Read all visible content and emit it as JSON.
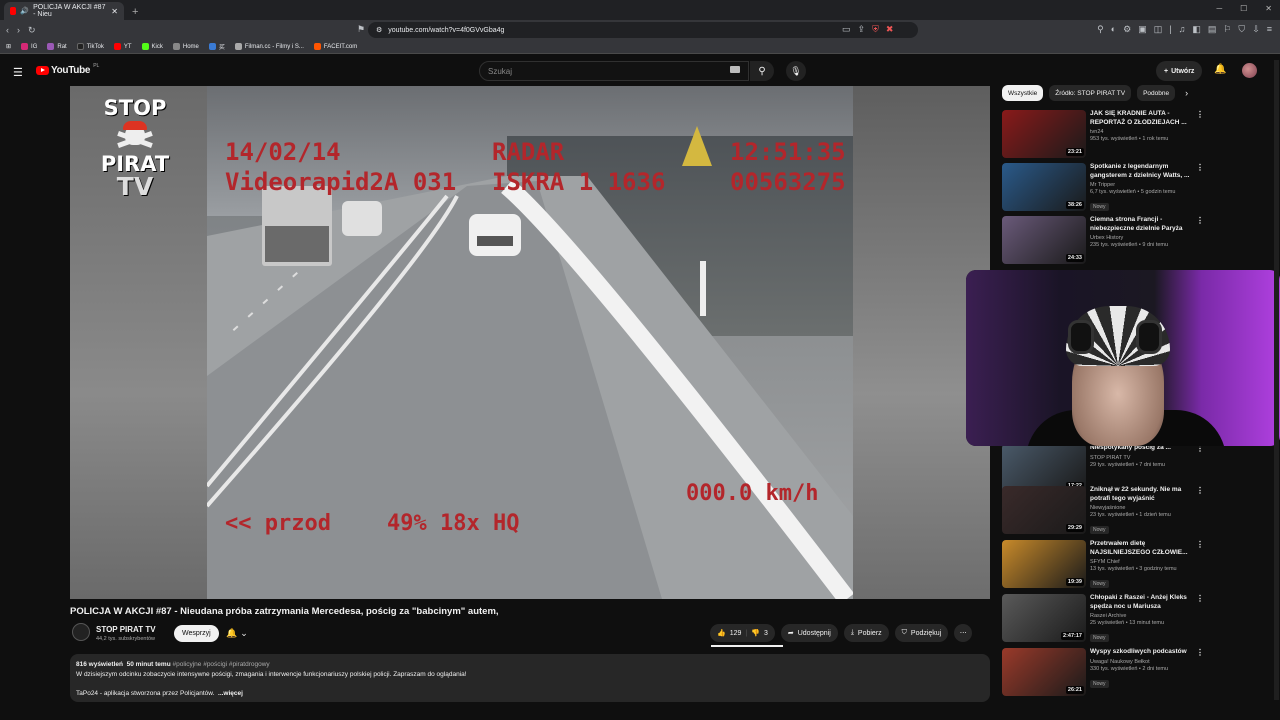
{
  "browser": {
    "tab_title": "POLICJA W AKCJI #87 - Nieu",
    "new_tab": "+",
    "url": "youtube.com/watch?v=4f0GVvGba4g",
    "bookmarks": [
      {
        "label": "IG",
        "color": "#d62976"
      },
      {
        "label": "Rat",
        "color": "#9b59b6"
      },
      {
        "label": "TikTok",
        "color": "#222222"
      },
      {
        "label": "YT",
        "color": "#ff0000"
      },
      {
        "label": "Kick",
        "color": "#53fc18"
      },
      {
        "label": "Home",
        "color": "#888888"
      },
      {
        "label": "买",
        "color": "#3a7bd5"
      },
      {
        "label": "Filman.cc - Filmy i S...",
        "color": "#aaaaaa"
      },
      {
        "label": "FACEIT.com",
        "color": "#ff5500"
      }
    ]
  },
  "youtube": {
    "logo": "YouTube",
    "region": "PL",
    "search_placeholder": "Szukaj",
    "create_label": "Utwórz"
  },
  "video": {
    "title": "POLICJA W AKCJI #87 - Nieudana próba zatrzymania Mercedesa, pościg za \"babcinym\" autem,",
    "overlay": {
      "date": "14/02/14",
      "radar": "RADAR",
      "time": "12:51:35",
      "device": "Videorapid2A 031",
      "iskra": "ISKRA 1 1636",
      "counter": "00563275",
      "speed": "000.0 km/h",
      "mode": "<< przod",
      "zoom": "49% 18x HQ"
    },
    "logo_lines": [
      "STOP",
      "PIRAT",
      "TV"
    ]
  },
  "channel": {
    "name": "STOP PIRAT TV",
    "subscribers": "44,2 tys. subskrybentów",
    "support_label": "Wesprzyj"
  },
  "actions": {
    "likes": "129",
    "dislikes": "3",
    "share": "Udostępnij",
    "download": "Pobierz",
    "thanks": "Podziękuj"
  },
  "description": {
    "views": "816 wyświetleń",
    "age": "50 minut temu",
    "tags": "#policyjne #pościgi #piratdrogowy",
    "line1": "W dzisiejszym odcinku zobaczycie intensywne pościgi, zmagania i interwencje funkcjonariuszy polskiej policji. Zapraszam do oglądania!",
    "line2": "TaPo24 - aplikacja stworzona przez Policjantów.",
    "more": "...więcej"
  },
  "chips": [
    "Wszystkie",
    "Źródło: STOP PIRAT TV",
    "Podobne"
  ],
  "recommendations": [
    {
      "title": "JAK SIĘ KRADNIE AUTA - REPORTAŻ O ZŁODZIEJACH ...",
      "channel": "tvn24",
      "meta": "953 tys. wyświetleń • 1 rok temu",
      "duration": "23:21",
      "new": "",
      "color": "#8a1a1a"
    },
    {
      "title": "Spotkanie z legendarnym gangsterem z dzielnicy Watts, ...",
      "channel": "Mr Tripper",
      "meta": "6,7 tys. wyświetleń • 5 godzin temu",
      "duration": "38:26",
      "new": "Nowy",
      "color": "#2a5a8a"
    },
    {
      "title": "Ciemna strona Francji - niebezpieczne dzielnie Paryża",
      "channel": "Urbex History",
      "meta": "235 tys. wyświetleń • 9 dni temu",
      "duration": "24:33",
      "new": "",
      "color": "#6a5a7a"
    },
    {
      "title": "Niespotykany pościg za ...",
      "channel": "STOP PIRAT TV",
      "meta": "29 tys. wyświetleń • 7 dni temu",
      "duration": "17:22",
      "new": "",
      "color": "#4a5a6a"
    },
    {
      "title": "Zniknął w 22 sekundy. Nie ma potrafi tego wyjaśnić",
      "channel": "Niewyjaśnione",
      "meta": "23 tys. wyświetleń • 1 dzień temu",
      "duration": "29:29",
      "new": "Nowy",
      "color": "#3a2a2a"
    },
    {
      "title": "Przetrwałem dietę NAJSILNIEJSZEGO CZŁOWIE...",
      "channel": "SFYM Chief",
      "meta": "13 tys. wyświetleń • 3 godziny temu",
      "duration": "19:39",
      "new": "Nowy",
      "color": "#c88a2a"
    },
    {
      "title": "Chłopaki z Raszei - Anżej Kleks spędza noc u Mariusza",
      "channel": "Raszei Archive",
      "meta": "25 wyświetleń • 13 minut temu",
      "duration": "2:47:17",
      "new": "Nowy",
      "color": "#5a5a5a"
    },
    {
      "title": "Wyspy szkodliwych podcastów",
      "channel": "Uwaga! Naukowy Bełkot",
      "meta": "330 tys. wyświetleń • 2 dni temu",
      "duration": "26:21",
      "new": "Nowy",
      "color": "#9a3a2a"
    }
  ]
}
